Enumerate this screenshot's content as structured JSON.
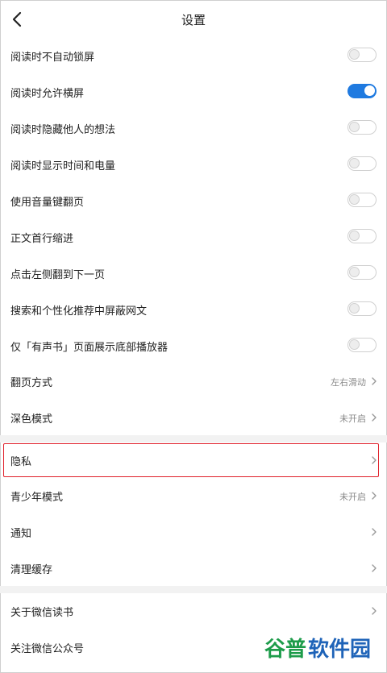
{
  "header": {
    "title": "设置",
    "back_icon": "chevron-left-icon"
  },
  "toggles": [
    {
      "label": "阅读时不自动锁屏",
      "on": false
    },
    {
      "label": "阅读时允许横屏",
      "on": true
    },
    {
      "label": "阅读时隐藏他人的想法",
      "on": false
    },
    {
      "label": "阅读时显示时间和电量",
      "on": false
    },
    {
      "label": "使用音量键翻页",
      "on": false
    },
    {
      "label": "正文首行缩进",
      "on": false
    },
    {
      "label": "点击左侧翻到下一页",
      "on": false
    },
    {
      "label": "搜索和个性化推荐中屏蔽网文",
      "on": false
    },
    {
      "label": "仅「有声书」页面展示底部播放器",
      "on": false
    }
  ],
  "nav_rows": [
    {
      "label": "翻页方式",
      "value": "左右滑动"
    },
    {
      "label": "深色模式",
      "value": "未开启"
    },
    {
      "label": "隐私",
      "value": ""
    },
    {
      "label": "青少年模式",
      "value": "未开启"
    },
    {
      "label": "通知",
      "value": ""
    },
    {
      "label": "清理缓存",
      "value": ""
    },
    {
      "label": "关于微信读书",
      "value": ""
    },
    {
      "label": "关注微信公众号",
      "value": ""
    }
  ],
  "colors": {
    "accent": "#1f7ae0",
    "highlight": "#e0202a",
    "watermark_green": "#1d9c4a",
    "watermark_blue": "#1e63b8"
  },
  "watermark": {
    "text": "谷普软件园"
  }
}
